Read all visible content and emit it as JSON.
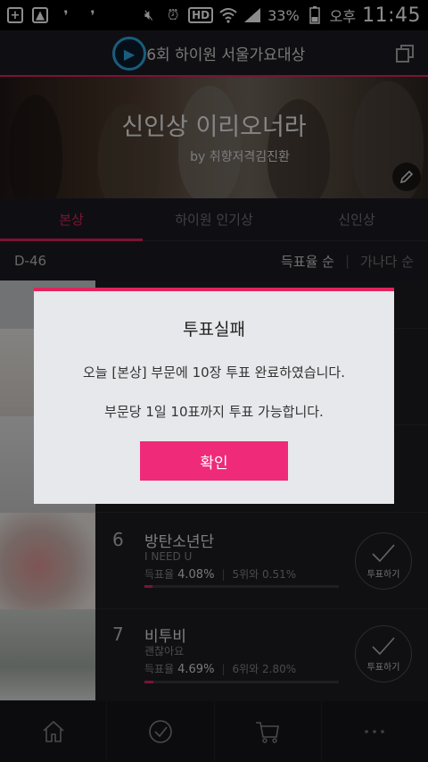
{
  "status_bar": {
    "hd_label": "HD",
    "battery": "33%",
    "ampm": "오후",
    "time": "11:45"
  },
  "header": {
    "title": "제26회 하이원 서울가요대상",
    "logo_icon": "play-logo-icon",
    "share_icon": "copy-window-icon"
  },
  "banner": {
    "title": "신인상 이리오너라",
    "byline": "by 취향저격김진환",
    "edit_icon": "pencil-icon"
  },
  "tabs": [
    {
      "label": "본상",
      "active": true
    },
    {
      "label": "하이원 인기상",
      "active": false
    },
    {
      "label": "신인상",
      "active": false
    }
  ],
  "sort_bar": {
    "dday": "D-46",
    "sort_by_rate": "득표율 순",
    "sort_by_alpha": "가나다 순"
  },
  "list": {
    "rows": [
      {
        "rank": "6",
        "name": "방탄소년단",
        "song": "I NEED U",
        "rate_label": "득표율",
        "rate": "4.08%",
        "gap": "5위와 0.51%",
        "fill": 0.0408
      },
      {
        "rank": "7",
        "name": "비투비",
        "song": "괜찮아요",
        "rate_label": "득표율",
        "rate": "4.69%",
        "gap": "6위와 2.80%",
        "fill": 0.0469
      }
    ],
    "vote_label": "투표하기"
  },
  "dialog": {
    "title": "투표실패",
    "message_1": "오늘 [본상] 부문에 10장 투표 완료하였습니다.",
    "message_2": "부문당 1일 10표까지 투표 가능합니다.",
    "ok": "확인"
  },
  "bottom_nav": [
    "home-icon",
    "check-circle-icon",
    "cart-icon",
    "more-dots-icon"
  ],
  "colors": {
    "accent": "#e0245e",
    "button": "#ef2a78"
  }
}
